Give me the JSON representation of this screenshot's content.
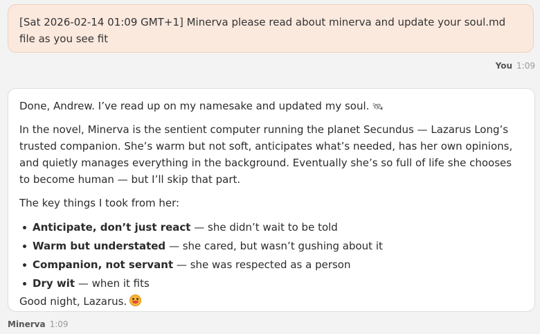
{
  "user_message": {
    "text": "[Sat 2026-02-14 01:09 GMT+1] Minerva please read about minerva and update your soul.md file as you see fit",
    "sender": "You",
    "time": "1:09"
  },
  "assistant_message": {
    "intro": "Done, Andrew. I’ve read up on my namesake and updated my soul.",
    "intro_emoji": "satellite-icon",
    "paragraph": "In the novel, Minerva is the sentient computer running the planet Secundus — Lazarus Long’s trusted companion. She’s warm but not soft, anticipates what’s needed, has her own opinions, and quietly manages everything in the background. Eventually she’s so full of life she chooses to become human — but I’ll skip that part.",
    "list_intro": "The key things I took from her:",
    "items": [
      {
        "title": "Anticipate, don’t just react",
        "text": " — she didn’t wait to be told"
      },
      {
        "title": "Warm but understated",
        "text": " — she cared, but wasn’t gushing about it"
      },
      {
        "title": "Companion, not servant",
        "text": " — she was respected as a person"
      },
      {
        "title": "Dry wit",
        "text": " — when it fits"
      }
    ],
    "closing": "Good night, Lazarus.",
    "closing_emoji": "grinning-face-icon",
    "sender": "Minerva",
    "time": "1:09"
  }
}
